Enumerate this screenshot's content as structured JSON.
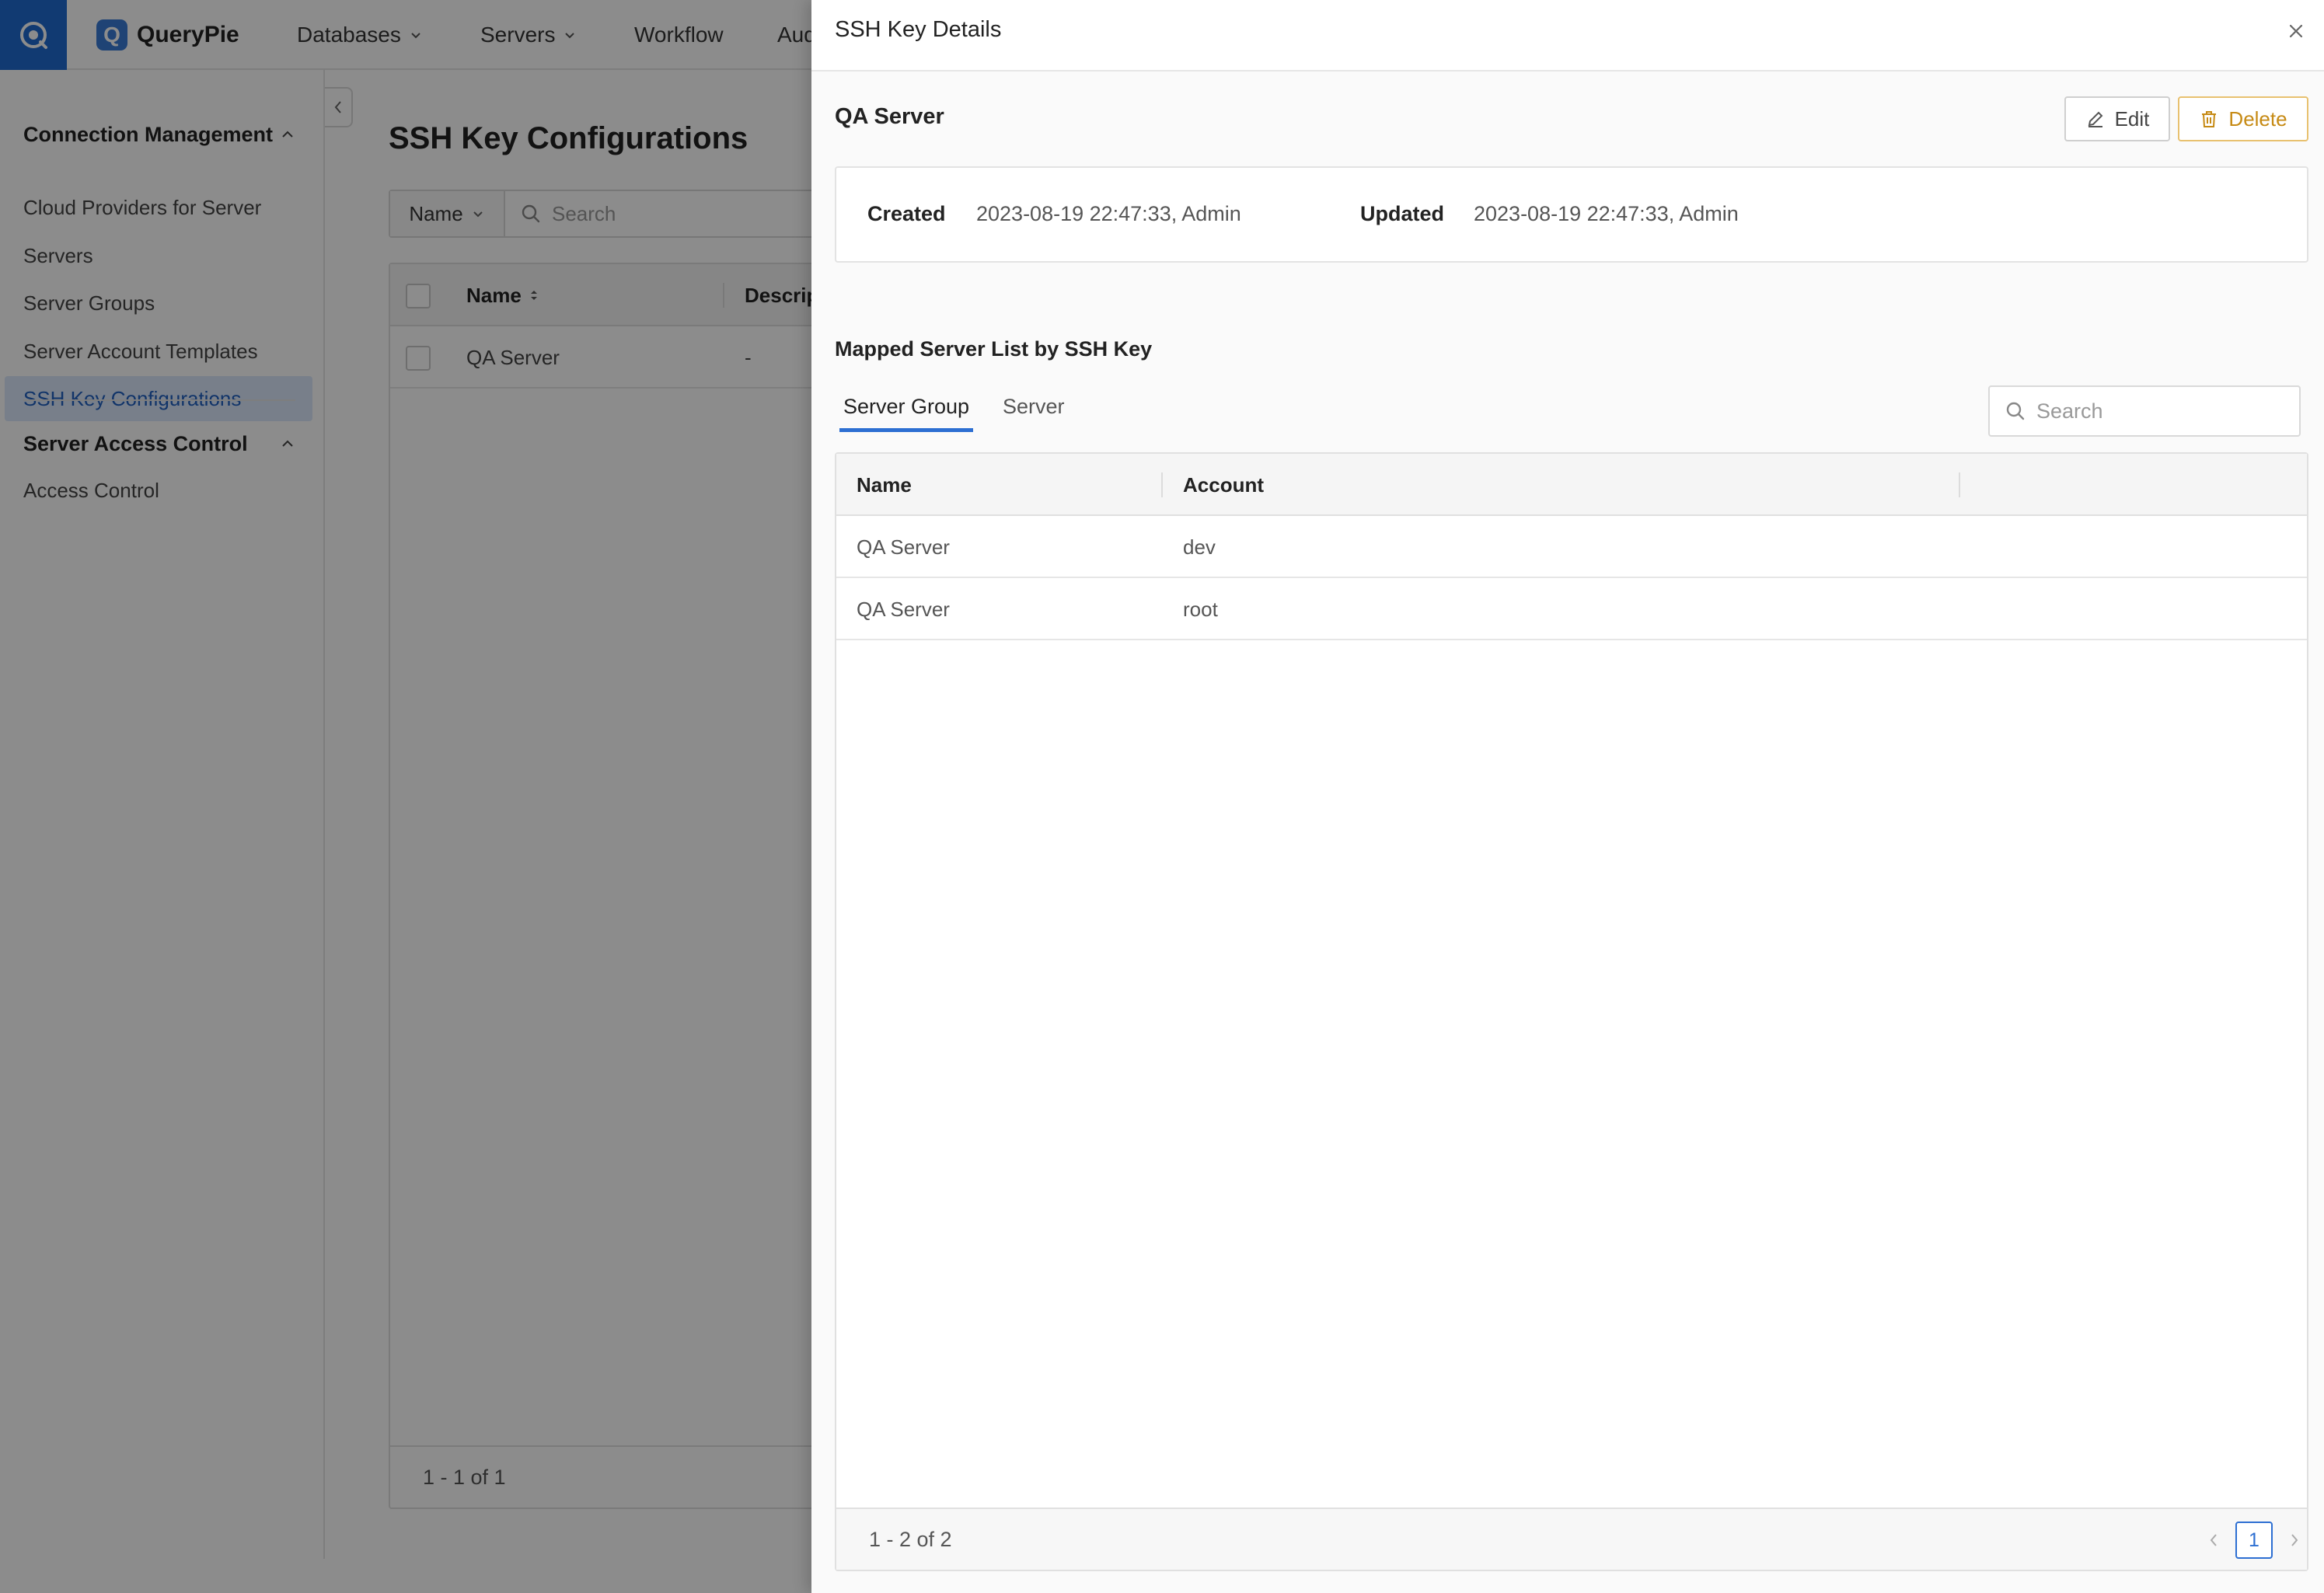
{
  "topnav": {
    "brand": "QueryPie",
    "brand_letter": "Q",
    "items": [
      "Databases",
      "Servers",
      "Workflow",
      "Aud"
    ]
  },
  "sidebar": {
    "section1": "Connection Management",
    "items": [
      "Cloud Providers for Server",
      "Servers",
      "Server Groups",
      "Server Account Templates",
      "SSH Key Configurations"
    ],
    "active_item": "SSH Key Configurations",
    "section2": "Server Access Control",
    "items2": [
      "Access Control"
    ]
  },
  "main": {
    "title": "SSH Key Configurations",
    "filter_field": "Name",
    "search_placeholder": "Search",
    "columns": [
      "Name",
      "Descrip"
    ],
    "rows": [
      {
        "name": "QA Server",
        "description": "-"
      }
    ],
    "pagination": "1 - 1 of 1"
  },
  "drawer": {
    "title": "SSH Key Details",
    "key_name": "QA Server",
    "edit_label": "Edit",
    "delete_label": "Delete",
    "created_label": "Created",
    "created_value": "2023-08-19 22:47:33, Admin",
    "updated_label": "Updated",
    "updated_value": "2023-08-19 22:47:33, Admin",
    "mapped_title": "Mapped Server List by SSH Key",
    "tabs": [
      "Server Group",
      "Server"
    ],
    "active_tab": "Server Group",
    "search_placeholder": "Search",
    "columns": [
      "Name",
      "Account"
    ],
    "rows": [
      {
        "name": "QA Server",
        "account": "dev"
      },
      {
        "name": "QA Server",
        "account": "root"
      }
    ],
    "pagination": "1 - 2 of 2",
    "current_page": "1"
  },
  "colors": {
    "brand_blue": "#1f6bd0",
    "accent_blue": "#2d6fd2",
    "delete_amber": "#c68a14",
    "active_item_bg": "#dbe8fb"
  },
  "icons": {
    "logo": "querypie-logo-icon",
    "close": "close-icon",
    "edit": "pencil-icon",
    "delete": "trash-icon",
    "search": "search-icon"
  }
}
